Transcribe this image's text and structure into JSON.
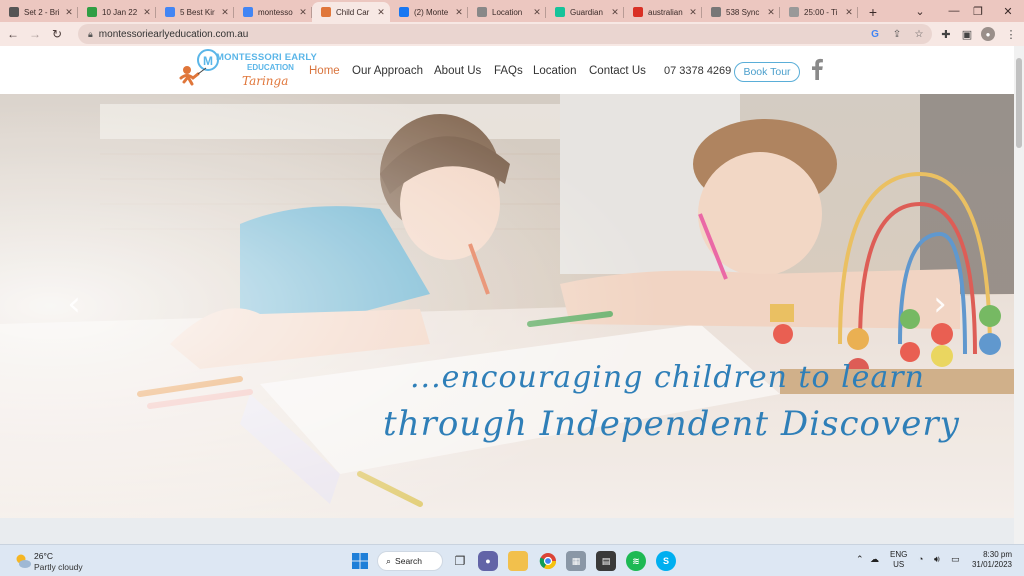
{
  "browser": {
    "tabs": [
      {
        "title": "Set 2 - Bri",
        "favicon": "book-icon",
        "color": "#555555"
      },
      {
        "title": "10 Jan 22",
        "favicon": "google-drive-icon",
        "color": "#2f9e44"
      },
      {
        "title": "5 Best Kir",
        "favicon": "docs-icon",
        "color": "#4285f4"
      },
      {
        "title": "montesso",
        "favicon": "google-icon",
        "color": "#4285f4"
      },
      {
        "title": "Child Car",
        "favicon": "site-icon",
        "color": "#e0763a"
      },
      {
        "title": "(2) Monte",
        "favicon": "facebook-icon",
        "color": "#1877f2"
      },
      {
        "title": "Location",
        "favicon": "pin-icon",
        "color": "#888888"
      },
      {
        "title": "Guardian",
        "favicon": "grammarly-icon",
        "color": "#15c39a"
      },
      {
        "title": "australian",
        "favicon": "pdf-icon",
        "color": "#d93025"
      },
      {
        "title": "538 Sync",
        "favicon": "sync-icon",
        "color": "#777777"
      },
      {
        "title": "25:00 - Ti",
        "favicon": "timer-icon",
        "color": "#999999"
      }
    ],
    "active_tab_index": 4,
    "url": "montessoriearlyeducation.com.au"
  },
  "site": {
    "logo": {
      "line1": "MONTESSORI EARLY",
      "line2": "EDUCATION",
      "line3": "Taringa"
    },
    "nav": [
      {
        "label": "Home",
        "active": true
      },
      {
        "label": "Our Approach",
        "active": false
      },
      {
        "label": "About Us",
        "active": false
      },
      {
        "label": "FAQs",
        "active": false
      },
      {
        "label": "Location",
        "active": false
      },
      {
        "label": "Contact Us",
        "active": false
      }
    ],
    "phone": "07 3378 4269",
    "cta": "Book Tour",
    "hero": {
      "tagline_line1": "...encouraging children to learn",
      "tagline_line2": "through Independent Discovery"
    },
    "colors": {
      "accent_orange": "#d9743d",
      "accent_blue": "#4b9fcc"
    }
  },
  "taskbar": {
    "weather_temp": "26°C",
    "weather_condition": "Partly cloudy",
    "search_label": "Search",
    "lang_line1": "ENG",
    "lang_line2": "US",
    "time": "8:30 pm",
    "date": "31/01/2023"
  }
}
